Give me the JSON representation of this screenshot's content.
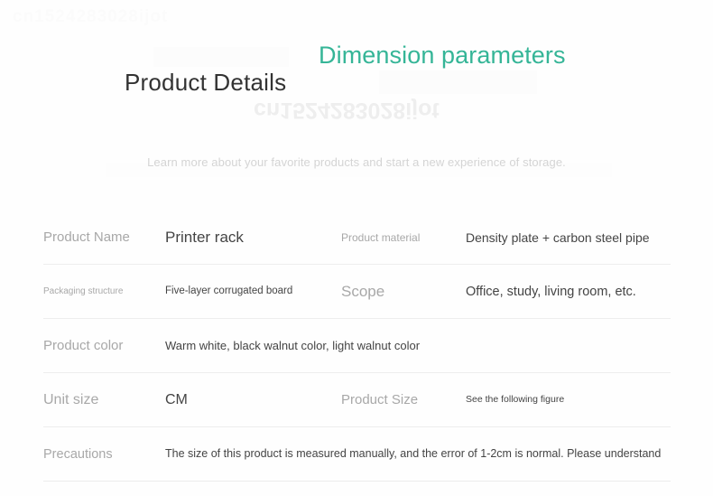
{
  "watermarks": {
    "top": "cn1524283028ijot",
    "middle": "cn1524283028ijot",
    "row_ghost": "cn1524283028ijot"
  },
  "header": {
    "title_main": "Product Details",
    "title_accent": "Dimension parameters",
    "subtitle": "Learn more about your favorite products and start a new experience of storage.",
    "accent_color": "#35b597",
    "title_color": "#333333",
    "subtitle_color": "#d4d4d4"
  },
  "spec_table": {
    "rows": [
      {
        "label1": "Product Name",
        "value1": "Printer rack",
        "label2": "Product material",
        "value2": "Density plate + carbon steel pipe"
      },
      {
        "label1": "Packaging structure",
        "value1": "Five-layer corrugated board",
        "label2": "Scope",
        "value2": "Office, study, living room, etc."
      },
      {
        "label1": "Product color",
        "value1": "Warm white, black walnut color, light walnut color",
        "label2": "",
        "value2": ""
      },
      {
        "label1": "Unit size",
        "value1": "CM",
        "label2": "Product Size",
        "value2": "See the following figure"
      },
      {
        "label1": "Precautions",
        "value1": "The size of this product is measured manually, and the error of 1-2cm is normal. Please understand",
        "label2": "",
        "value2": ""
      }
    ]
  }
}
